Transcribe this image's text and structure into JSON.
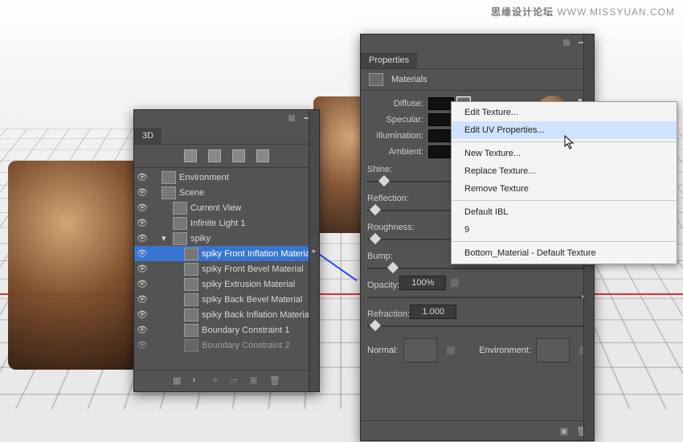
{
  "watermark": {
    "cn": "思缘设计论坛",
    "url": "WWW.MISSYUAN.COM"
  },
  "panel3d": {
    "title": "3D",
    "items": [
      {
        "indent": 0,
        "label": "Environment",
        "ico": "env"
      },
      {
        "indent": 0,
        "label": "Scene",
        "ico": "scene"
      },
      {
        "indent": 1,
        "label": "Current View",
        "ico": "cam"
      },
      {
        "indent": 1,
        "label": "Infinite Light 1",
        "ico": "light"
      },
      {
        "indent": 1,
        "label": "spiky",
        "ico": "mesh",
        "expanded": true
      },
      {
        "indent": 2,
        "label": "spiky Front Inflation Material",
        "ico": "mat",
        "selected": true
      },
      {
        "indent": 2,
        "label": "spiky Front Bevel Material",
        "ico": "mat"
      },
      {
        "indent": 2,
        "label": "spiky Extrusion Material",
        "ico": "mat"
      },
      {
        "indent": 2,
        "label": "spiky Back Bevel Material",
        "ico": "mat"
      },
      {
        "indent": 2,
        "label": "spiky Back Inflation Material",
        "ico": "mat"
      },
      {
        "indent": 2,
        "label": "Boundary Constraint 1",
        "ico": "con"
      },
      {
        "indent": 2,
        "label": "Boundary Constraint 2",
        "ico": "con",
        "dim": true
      }
    ]
  },
  "properties": {
    "title": "Properties",
    "subtitle": "Materials",
    "swatches": [
      {
        "label": "Diffuse:",
        "chipSelected": true
      },
      {
        "label": "Specular:"
      },
      {
        "label": "Illumination:"
      },
      {
        "label": "Ambient:"
      }
    ],
    "sliders": [
      {
        "label": "Shine:",
        "pos": 0.06
      },
      {
        "label": "Reflection:",
        "pos": 0.02
      },
      {
        "label": "Roughness:",
        "pos": 0.02
      },
      {
        "label": "Bump:",
        "pos": 0.1
      },
      {
        "label": "Opacity:",
        "pos": 0.98,
        "value": "100%",
        "folder": true
      },
      {
        "label": "Refraction:",
        "pos": 0.02,
        "value": "1.000"
      }
    ],
    "normal": "Normal:",
    "environment": "Environment:"
  },
  "menu": {
    "items": [
      {
        "label": "Edit Texture..."
      },
      {
        "label": "Edit UV Properties...",
        "highlight": true
      },
      {
        "sep": true
      },
      {
        "label": "New Texture..."
      },
      {
        "label": "Replace Texture..."
      },
      {
        "label": "Remove Texture"
      },
      {
        "sep": true
      },
      {
        "label": "Default IBL"
      },
      {
        "label": "9"
      },
      {
        "sep": true
      },
      {
        "label": "Bottom_Material - Default Texture"
      }
    ]
  }
}
